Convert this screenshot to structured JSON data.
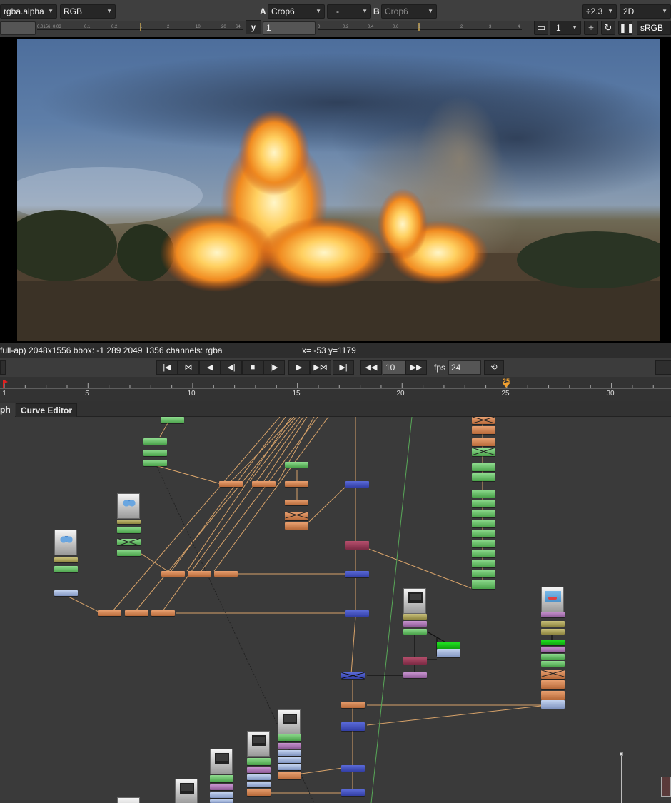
{
  "toolbar": {
    "channels": "rgba.alpha",
    "colorspace": "RGB",
    "input_a_label": "A",
    "input_a": "Crop6",
    "compare_mode": "-",
    "input_b_label": "B",
    "input_b": "Crop6",
    "gain_ticks": [
      "0.0156",
      "0.03",
      "0.1",
      "0.2",
      "1",
      "2",
      "10",
      "20",
      "64"
    ],
    "gamma_label": "y",
    "gamma_value": "1",
    "gamma_ticks": [
      "0",
      "0.2",
      "0.4",
      "0.6",
      "1",
      "2",
      "3",
      "4"
    ],
    "proxy": "÷2.3",
    "view_mode": "2D",
    "downrez": "1",
    "lut": "sRGB"
  },
  "info_bar": {
    "format": "full-ap) 2048x1556  bbox: -1 289 2049 1356  channels: rgba",
    "coords": "x= -53 y=1179"
  },
  "transport": {
    "increment": "10",
    "fps_label": "fps",
    "fps": "24"
  },
  "timeline": {
    "ticks": [
      "1",
      "5",
      "10",
      "15",
      "20",
      "25",
      "30"
    ],
    "current_frame": "25"
  },
  "tabs": [
    {
      "label": "ph"
    },
    {
      "label": "Curve Editor"
    }
  ],
  "colors": {
    "read_node": "#8fdc8f",
    "transform_node": "#e8a070",
    "merge_node": "#5a6ad8",
    "grade_node": "#b8506e",
    "current_frame_marker": "#f0a030"
  }
}
